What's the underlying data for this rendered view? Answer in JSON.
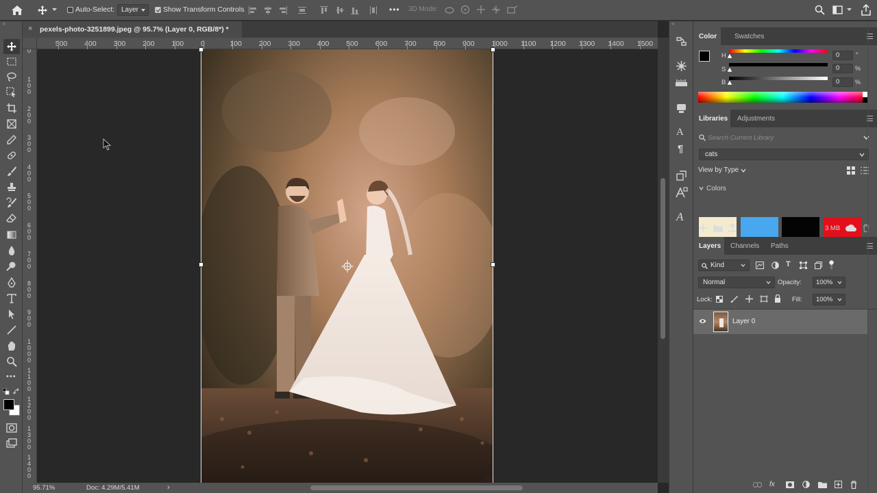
{
  "options_bar": {
    "auto_select_label": "Auto-Select:",
    "auto_select_value": "Layer",
    "show_transform_label": "Show Transform Controls",
    "mode_3d_label": "3D Mode:",
    "more": "•••"
  },
  "document": {
    "tab_title": "pexels-photo-3251899.jpeg @ 95.7% (Layer 0, RGB/8*) *",
    "close": "×"
  },
  "ruler_h": [
    "500",
    "400",
    "300",
    "200",
    "100",
    "0",
    "100",
    "200",
    "300",
    "400",
    "500",
    "600",
    "700",
    "800",
    "900",
    "1000",
    "1100",
    "1200",
    "1300",
    "1400",
    "1500"
  ],
  "ruler_v": [
    [
      "0"
    ],
    [
      "1",
      "0",
      "0"
    ],
    [
      "2",
      "0",
      "0"
    ],
    [
      "3",
      "0",
      "0"
    ],
    [
      "4",
      "0",
      "0"
    ],
    [
      "5",
      "0",
      "0"
    ],
    [
      "6",
      "0",
      "0"
    ],
    [
      "7",
      "0",
      "0"
    ],
    [
      "8",
      "0",
      "0"
    ],
    [
      "9",
      "0",
      "0"
    ],
    [
      "1",
      "0",
      "0",
      "0"
    ],
    [
      "1",
      "1",
      "0",
      "0"
    ],
    [
      "1",
      "2",
      "0",
      "0"
    ],
    [
      "1",
      "3",
      "0",
      "0"
    ],
    [
      "1",
      "4",
      "0",
      "0"
    ]
  ],
  "status": {
    "zoom": "95.71%",
    "doc": "Doc: 4.29M/5.41M",
    "arrow": "›"
  },
  "color_panel": {
    "tabs": [
      "Color",
      "Swatches"
    ],
    "h_label": "H",
    "h_value": "0",
    "h_unit": "°",
    "s_label": "S",
    "s_value": "0",
    "s_unit": "%",
    "b_label": "B",
    "b_value": "0",
    "b_unit": "%"
  },
  "libraries_panel": {
    "tabs": [
      "Libraries",
      "Adjustments"
    ],
    "search_placeholder": "Search Current Library",
    "library": "cats",
    "view_by": "View by Type",
    "colors_section": "Colors",
    "swatches": [
      "#f4ebcf",
      "#48a7ee",
      "#040404",
      "#e2101c"
    ],
    "size": "3 MB"
  },
  "layers_panel": {
    "tabs": [
      "Layers",
      "Channels",
      "Paths"
    ],
    "kind": "Kind",
    "blend": "Normal",
    "opacity_label": "Opacity:",
    "opacity_value": "100%",
    "lock_label": "Lock:",
    "fill_label": "Fill:",
    "fill_value": "100%",
    "layers": [
      {
        "name": "Layer 0"
      }
    ]
  },
  "colors": {
    "accent": "#e0e0e0",
    "panel": "#535353",
    "canvas": "#282828"
  }
}
